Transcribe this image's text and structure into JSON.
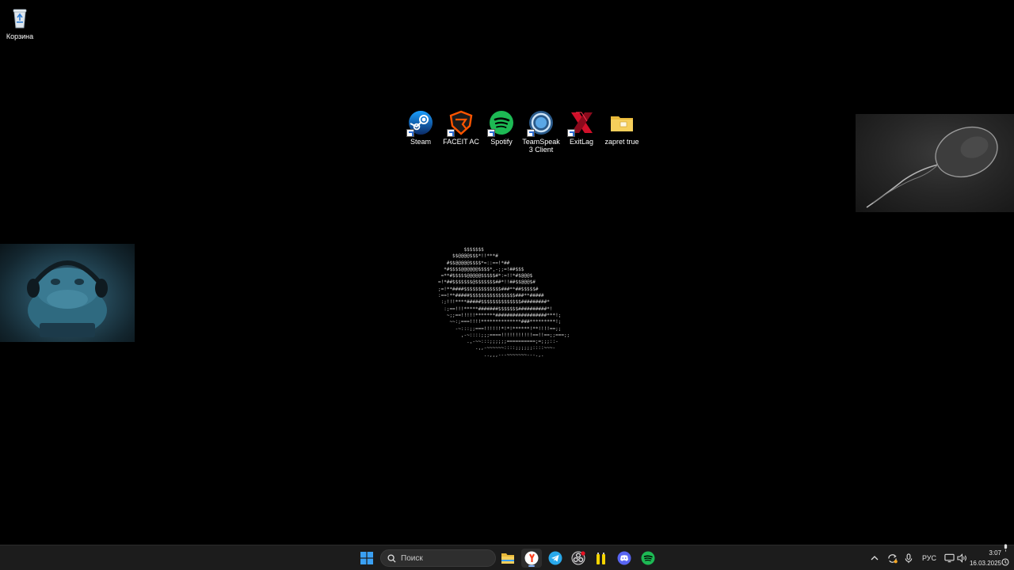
{
  "desktop": {
    "recycle_bin": {
      "label": "Корзина"
    },
    "shortcuts": [
      {
        "label": "Steam",
        "icon": "steam-icon"
      },
      {
        "label": "FACEIT AC",
        "icon": "faceit-icon"
      },
      {
        "label": "Spotify",
        "icon": "spotify-icon"
      },
      {
        "label": "TeamSpeak 3 Client",
        "icon": "teamspeak-icon"
      },
      {
        "label": "ExitLag",
        "icon": "exitlag-icon"
      },
      {
        "label": "zapret true",
        "icon": "folder-icon"
      }
    ],
    "ascii_art": "         $$$$$$$\n     $$@@@@$$$*!!***#\n   #$$@@@@@$$$$*=::==!*##\n  *#$$$$@@@@@@$$$$*,-;;=!##$$$\n =**#$$$$$@@@@@$$$$$#*:=!!*#$@@@$\n=!*##$$$$$$$@$$$$$$$##*!!##$$@@@$#\n;=!**####$$$$$$$$$$$$$###**##$$$$$#\n:==!**#####$$$$$$$$$$$$$$$$###**#####\n :;!!!****#####$$$$$$$$$$$$$$#########*\n  :;==!!!*****#######$$$$$$$##########*!\n   ~;;==!!!!!*******##################***!;\n    ~~:;===!!!!**************###*********!;\n      -~:::;;===!!!!!!*!*!******!**!!!!==;;\n        ,-~::::;;;====!!!!!!!!!!!==!!==;;===;;\n          .,-~~:::;;;;;;==========;=;;;::-\n             .,,-~~~~~~::::;;;;;;::::~~~-\n                ..,,,---~~~~~~~---.,."
  },
  "taskbar": {
    "search": {
      "placeholder": "Поиск"
    },
    "apps": [
      {
        "name": "file-explorer-icon",
        "active": false
      },
      {
        "name": "yandex-browser-icon",
        "active": true
      },
      {
        "name": "telegram-icon",
        "active": false
      },
      {
        "name": "obs-icon",
        "active": false
      },
      {
        "name": "energy-drink-app-icon",
        "active": false
      },
      {
        "name": "discord-icon",
        "active": false
      },
      {
        "name": "spotify-icon",
        "active": false
      }
    ],
    "tray": {
      "language": "РУС",
      "time": "3:07",
      "date": "16.03.2025"
    }
  },
  "colors": {
    "taskbar_bg": "#1c1c1c",
    "accent": "#8ab4f8",
    "spotify_green": "#1db954",
    "discord_blurple": "#5865f2",
    "telegram_blue": "#29a9eb",
    "yandex_red": "#fc3f1d"
  }
}
